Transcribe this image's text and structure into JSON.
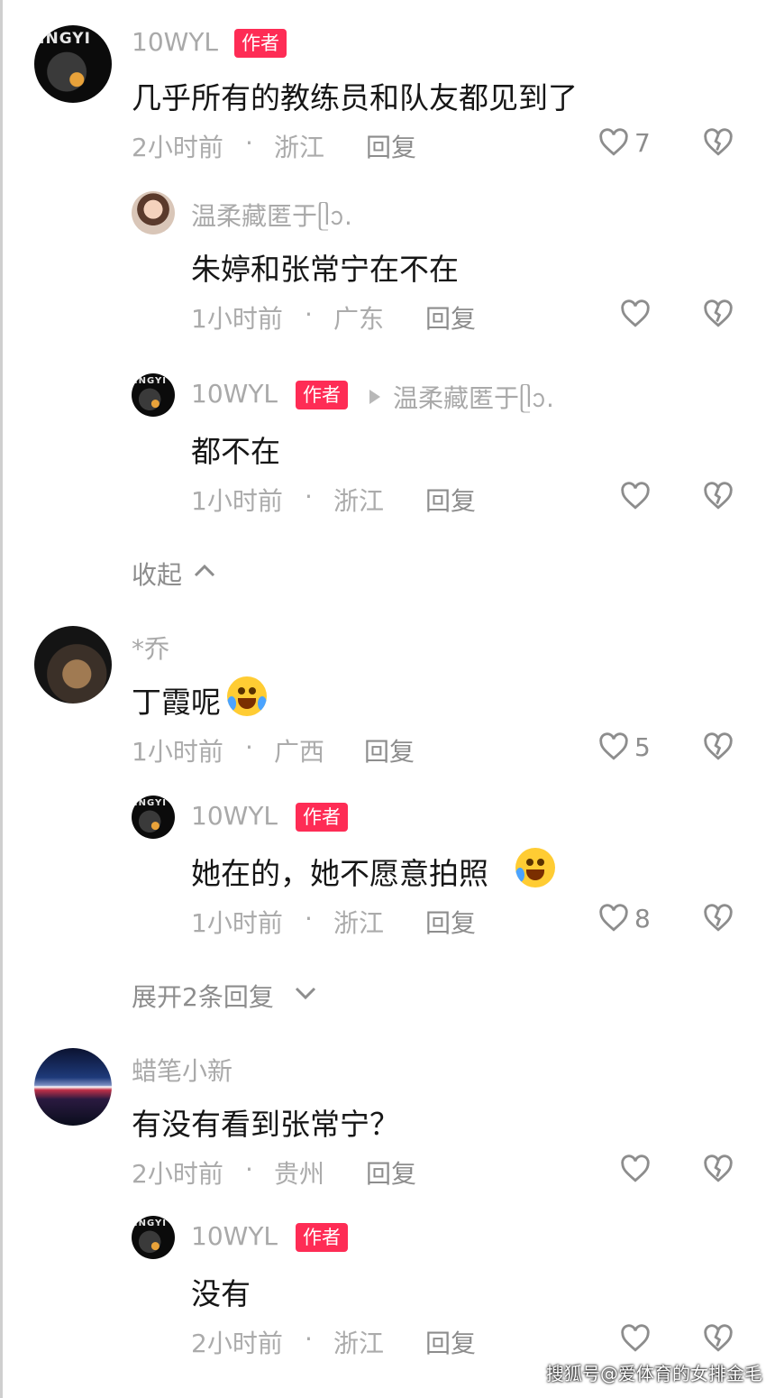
{
  "colors": {
    "author_badge": "#fe2c55",
    "name": "#a9a9a9",
    "meta": "#ababab",
    "text": "#161616"
  },
  "comments": [
    {
      "avatar_text": "INGYI",
      "name": "10WYL",
      "badge": "作者",
      "text": "几乎所有的教练员和队友都见到了",
      "time": "2小时前",
      "dot": "·",
      "location": "浙江",
      "reply": "回复",
      "likes": "7",
      "replies": [
        {
          "name": "温柔藏匿于ᥫᩣ.",
          "text": "朱婷和张常宁在不在",
          "time": "1小时前",
          "dot": "·",
          "location": "广东",
          "reply": "回复"
        },
        {
          "avatar_text": "INGYI",
          "name": "10WYL",
          "badge": "作者",
          "reply_to": "温柔藏匿于ᥫᩣ.",
          "text": "都不在",
          "time": "1小时前",
          "dot": "·",
          "location": "浙江",
          "reply": "回复"
        }
      ],
      "toggle": "收起"
    },
    {
      "name": "*乔",
      "text": "丁霞呢",
      "emoji": "crying-laughing-emoji",
      "time": "1小时前",
      "dot": "·",
      "location": "广西",
      "reply": "回复",
      "likes": "5",
      "replies": [
        {
          "avatar_text": "INGYI",
          "name": "10WYL",
          "badge": "作者",
          "text": "她在的，她不愿意拍照",
          "emoji": "rolling-laughing-emoji",
          "time": "1小时前",
          "dot": "·",
          "location": "浙江",
          "reply": "回复",
          "likes": "8"
        }
      ],
      "toggle": "展开2条回复"
    },
    {
      "name": "蜡笔小新",
      "text": "有没有看到张常宁？",
      "time": "2小时前",
      "dot": "·",
      "location": "贵州",
      "reply": "回复",
      "replies": [
        {
          "avatar_text": "INGYI",
          "name": "10WYL",
          "badge": "作者",
          "text": "没有",
          "time": "2小时前",
          "dot": "·",
          "location": "浙江",
          "reply": "回复"
        }
      ]
    }
  ],
  "watermark": "搜狐号@爱体育的女排金毛"
}
